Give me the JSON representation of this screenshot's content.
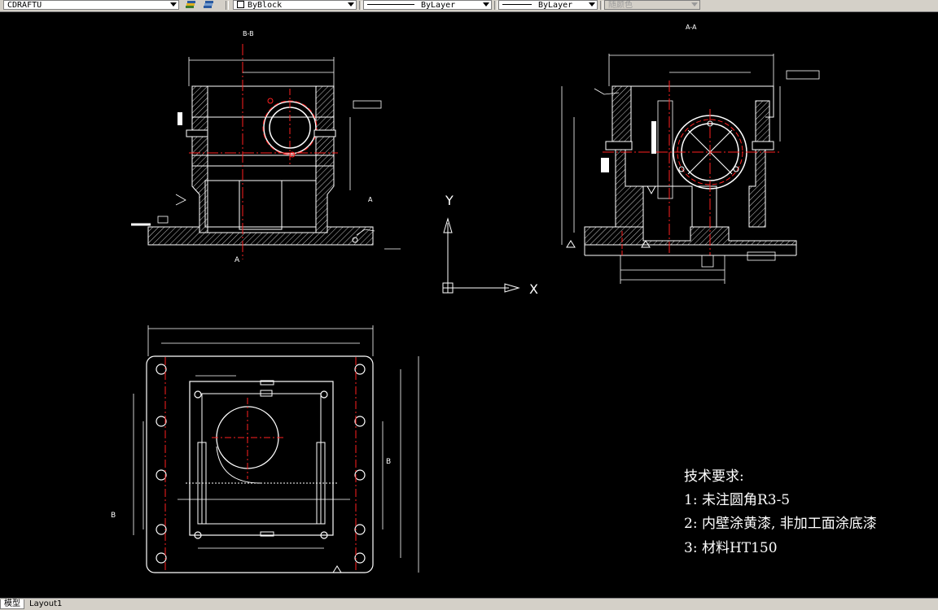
{
  "toolbar": {
    "layer_combo_value": "CDRAFTU",
    "color_combo_value": "ByBlock",
    "linetype_combo_value": "ByLayer",
    "lineweight_combo_value": "ByLayer",
    "plotstyle_combo_value": "随颜色"
  },
  "views": {
    "section_bb_label": "B-B",
    "section_aa_label": "A-A",
    "label_a_bottom": "A",
    "label_a_right": "A",
    "label_b_left": "B",
    "label_b_right": "B"
  },
  "ucs": {
    "x_label": "X",
    "y_label": "Y"
  },
  "notes": {
    "title": "技术要求:",
    "items": [
      "1: 未注圆角R3-5",
      "2: 内壁涂黄漆, 非加工面涂底漆",
      "3: 材料HT150"
    ]
  },
  "tabs": [
    {
      "label": "模型",
      "active": true
    },
    {
      "label": "Layout1",
      "active": false
    }
  ],
  "colors": {
    "background": "#000000",
    "geometry": "#ffffff",
    "centerline": "#ff2020",
    "hatch": "#c0c0c0"
  }
}
